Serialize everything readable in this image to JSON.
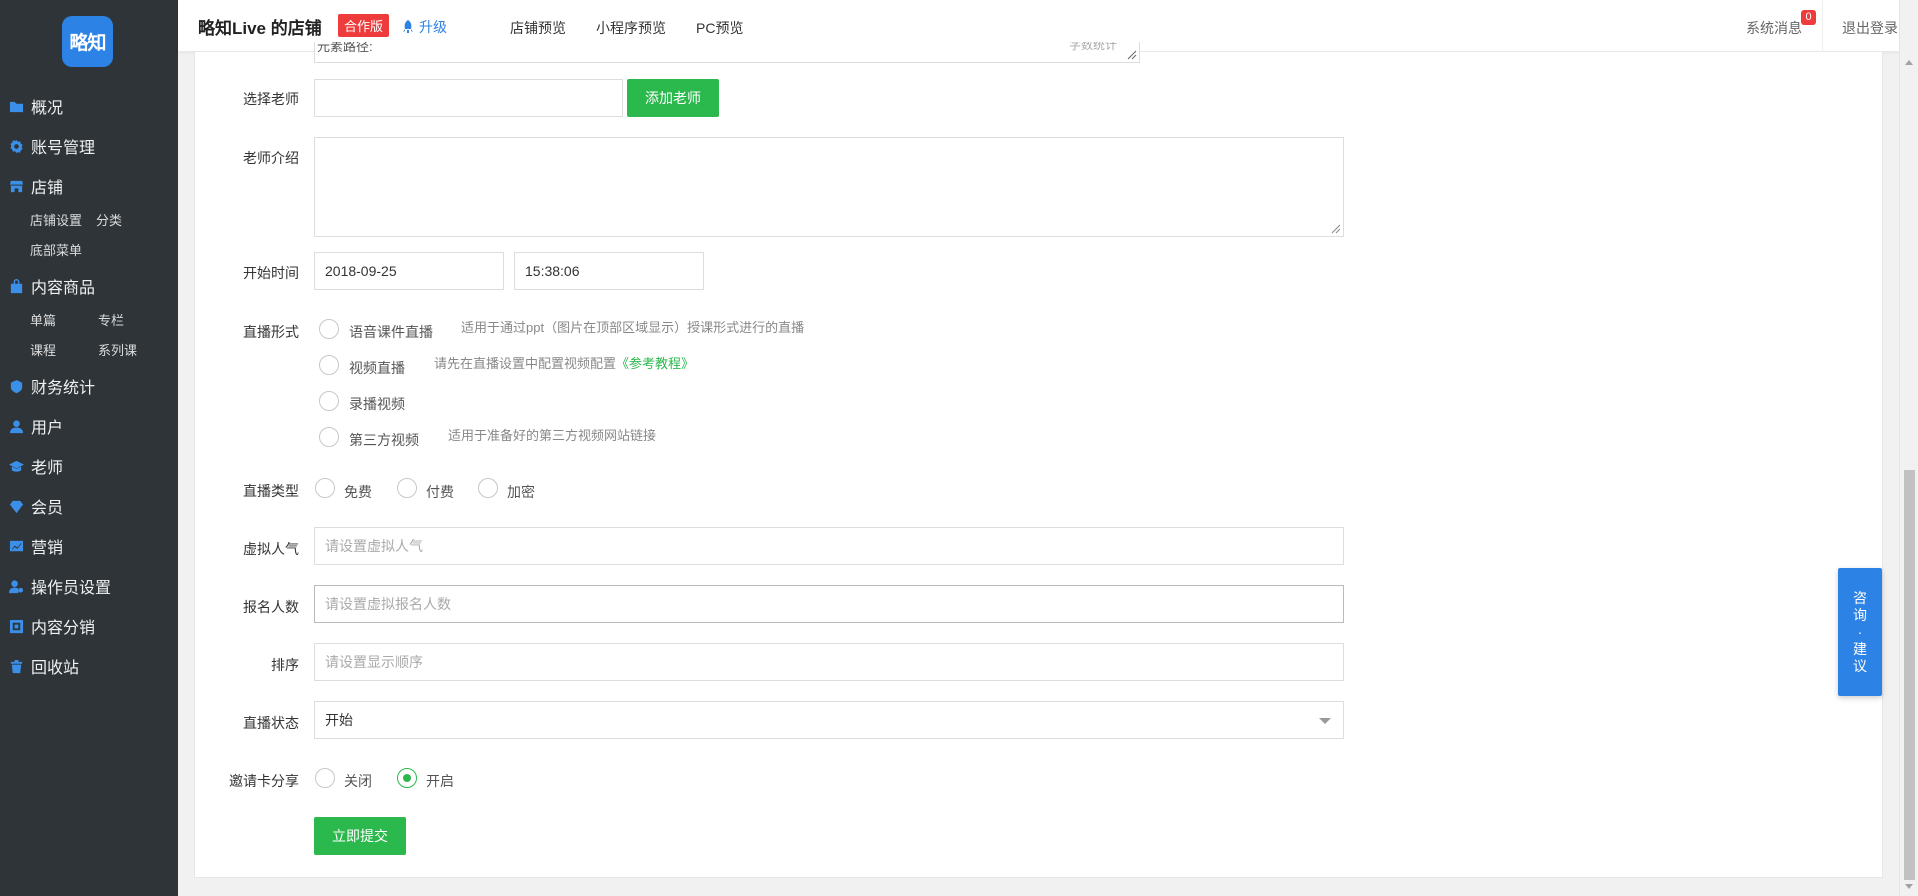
{
  "sidebar": {
    "logo": "略知",
    "items": [
      {
        "label": "概况",
        "icon": "folder-icon"
      },
      {
        "label": "账号管理",
        "icon": "gear-icon"
      },
      {
        "label": "店铺",
        "icon": "store-icon"
      },
      {
        "label": "内容商品",
        "icon": "bag-icon"
      },
      {
        "label": "财务统计",
        "icon": "finance-icon"
      },
      {
        "label": "用户",
        "icon": "user-icon"
      },
      {
        "label": "老师",
        "icon": "teacher-icon"
      },
      {
        "label": "会员",
        "icon": "diamond-icon"
      },
      {
        "label": "营销",
        "icon": "chart-icon"
      },
      {
        "label": "操作员设置",
        "icon": "operator-icon"
      },
      {
        "label": "内容分销",
        "icon": "distribution-icon"
      },
      {
        "label": "回收站",
        "icon": "trash-icon"
      }
    ],
    "store_sub": [
      "店铺设置",
      "分类",
      "底部菜单"
    ],
    "content_sub": [
      "单篇",
      "专栏",
      "课程",
      "系列课"
    ]
  },
  "topbar": {
    "shop_title": "略知Live 的店铺",
    "edition_badge": "合作版",
    "upgrade": "升级",
    "nav": [
      "店铺预览",
      "小程序预览",
      "PC预览"
    ],
    "system_messages": "系统消息",
    "message_count": "0",
    "logout": "退出登录"
  },
  "form": {
    "top_textarea_cut": "元素路径:",
    "top_textarea_count": "字数统计",
    "teacher": {
      "label": "选择老师",
      "value": "",
      "add_button": "添加老师"
    },
    "teacher_intro": {
      "label": "老师介绍",
      "value": ""
    },
    "start_time": {
      "label": "开始时间",
      "date": "2018-09-25",
      "time": "15:38:06"
    },
    "live_form": {
      "label": "直播形式",
      "options": [
        {
          "label": "语音课件直播",
          "hint": "适用于通过ppt（图片在顶部区域显示）授课形式进行的直播"
        },
        {
          "label": "视频直播",
          "hint": "请先在直播设置中配置视频配置",
          "link": "《参考教程》"
        },
        {
          "label": "录播视频",
          "hint": ""
        },
        {
          "label": "第三方视频",
          "hint": "适用于准备好的第三方视频网站链接"
        }
      ]
    },
    "live_type": {
      "label": "直播类型",
      "options": [
        "免费",
        "付费",
        "加密"
      ]
    },
    "virtual_popularity": {
      "label": "虚拟人气",
      "placeholder": "请设置虚拟人气"
    },
    "signup_count": {
      "label": "报名人数",
      "placeholder": "请设置虚拟报名人数"
    },
    "sort": {
      "label": "排序",
      "placeholder": "请设置显示顺序"
    },
    "live_status": {
      "label": "直播状态",
      "value": "开始"
    },
    "invite_share": {
      "label": "邀请卡分享",
      "options": [
        "关闭",
        "开启"
      ],
      "selected": "开启"
    },
    "submit": "立即提交"
  },
  "consult": "咨询·建议"
}
